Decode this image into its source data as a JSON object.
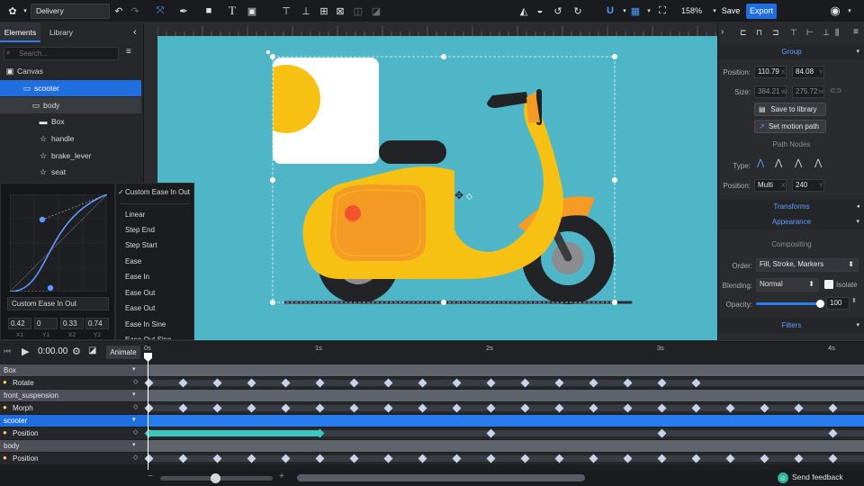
{
  "toolbar": {
    "document_name": "Delivery",
    "zoom": "158%",
    "save_label": "Save",
    "export_label": "Export"
  },
  "left_panel": {
    "tabs": [
      "Elements",
      "Library"
    ],
    "search_placeholder": "Search...",
    "tree": [
      {
        "label": "Canvas",
        "icon": "canvas-icon"
      },
      {
        "label": "scooter",
        "icon": "folder-icon",
        "selected": true
      },
      {
        "label": "body",
        "icon": "folder-icon"
      },
      {
        "label": "Box",
        "icon": "folder-icon"
      },
      {
        "label": "handle",
        "icon": "path-icon"
      },
      {
        "label": "brake_lever",
        "icon": "path-icon"
      },
      {
        "label": "seat",
        "icon": "path-icon"
      }
    ]
  },
  "easing": {
    "current": "Custom Ease In Out",
    "values": [
      "0.42",
      "0",
      "0.33",
      "0.74"
    ],
    "value_labels": [
      "X1",
      "Y1",
      "X2",
      "Y2"
    ],
    "options": [
      "Custom Ease In Out",
      "Linear",
      "Step End",
      "Step Start",
      "Ease",
      "Ease In",
      "Ease Out",
      "Ease Out",
      "Ease In Sine",
      "Ease Out Sine"
    ]
  },
  "right_panel": {
    "group_header": "Group",
    "position_label": "Position:",
    "position_x": "110.79",
    "position_y": "84.08",
    "size_label": "Size:",
    "size_w": "384.21",
    "size_h": "275.72",
    "unit_x": "X",
    "unit_y": "Y",
    "unit_w": "W",
    "unit_h": "H",
    "save_library": "Save to library",
    "motion_path": "Set motion path",
    "path_nodes_title": "Path Nodes",
    "type_label": "Type:",
    "node_position_label": "Position:",
    "node_position_x": "Multi",
    "node_position_y": "240",
    "transforms_header": "Transforms",
    "appearance_header": "Appearance",
    "compositing_title": "Compositing",
    "order_label": "Order:",
    "order_value": "Fill, Stroke, Markers",
    "blending_label": "Blending:",
    "blending_value": "Normal",
    "isolate_label": "Isolate",
    "opacity_label": "Opacity:",
    "opacity_value": "100",
    "opacity_fraction": 1.0,
    "filters_header": "Filters"
  },
  "timeline": {
    "time": "0:00.00",
    "animate_label": "Animate",
    "ticks": [
      "0s",
      "1s",
      "2s",
      "3s",
      "4s"
    ],
    "tracks": [
      {
        "name": "Box",
        "kind": "group"
      },
      {
        "name": "Rotate",
        "kind": "property"
      },
      {
        "name": "front_suspension",
        "kind": "group"
      },
      {
        "name": "Morph",
        "kind": "property"
      },
      {
        "name": "scooter",
        "kind": "group",
        "selected": true
      },
      {
        "name": "Position",
        "kind": "property"
      },
      {
        "name": "body",
        "kind": "group"
      },
      {
        "name": "Position",
        "kind": "property"
      }
    ],
    "feedback_label": "Send feedback"
  },
  "colors": {
    "accent": "#1f6fe0",
    "selection": "#1f6fe0",
    "artboard_bg": "#4fb6c8",
    "scooter_yellow": "#f7c114",
    "scooter_orange": "#f59a24",
    "tire": "#222327"
  }
}
